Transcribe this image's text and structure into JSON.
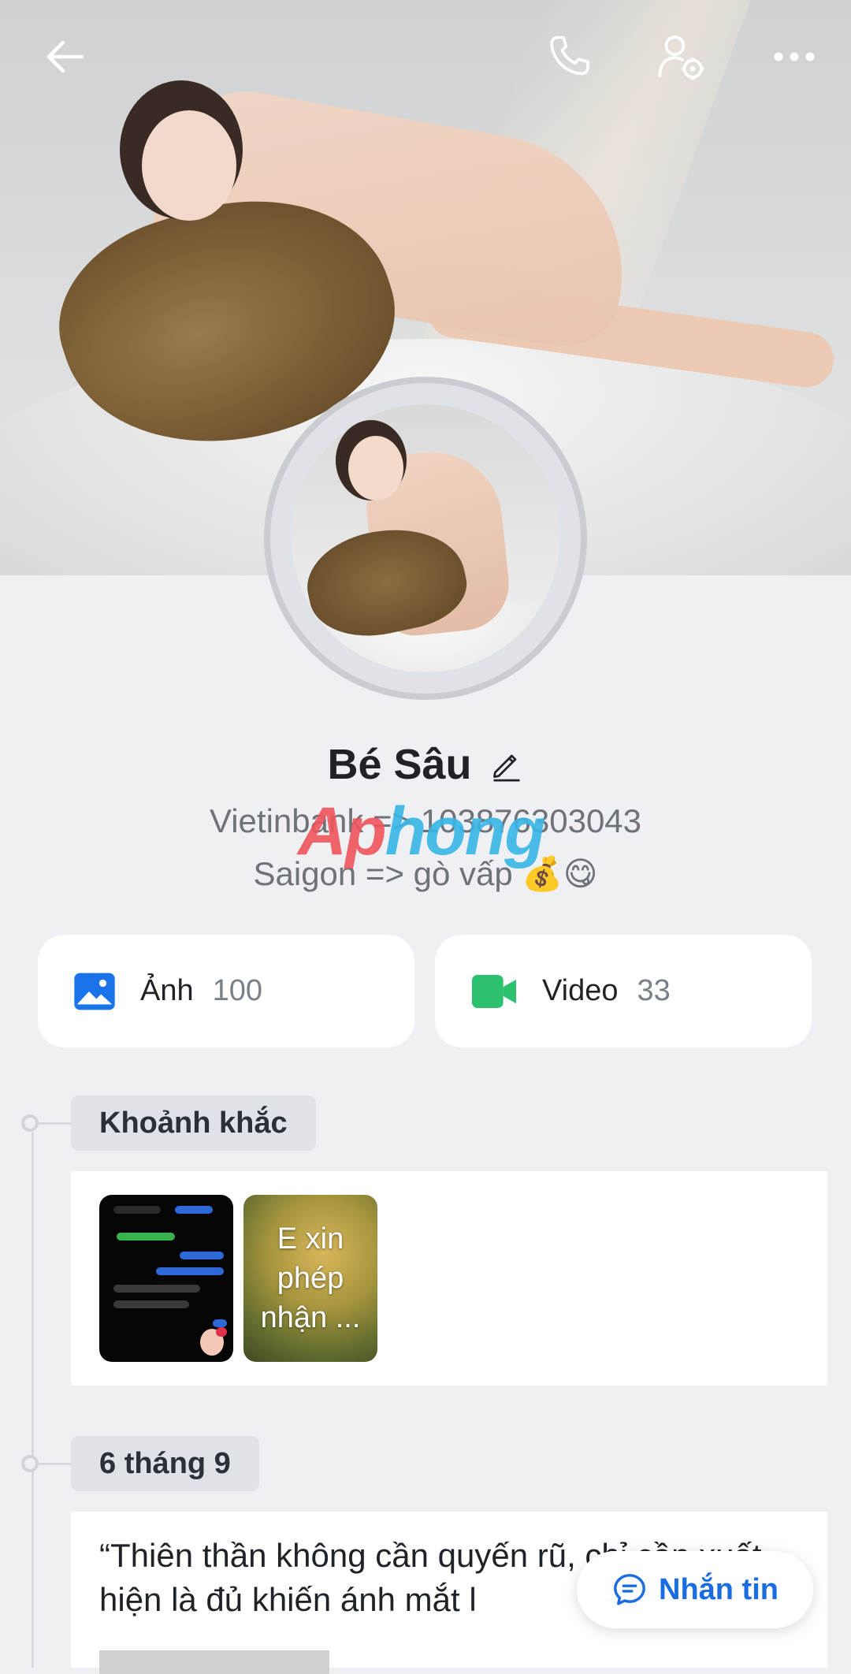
{
  "header": {
    "back_icon": "arrow-left-icon",
    "call_icon": "phone-icon",
    "settings_icon": "user-settings-icon",
    "more_icon": "more-horizontal-icon"
  },
  "profile": {
    "name": "Bé Sâu",
    "bio_line1": "Vietinbank => 103876303043",
    "bio_line2": "Saigon => gò vấp 💰😋",
    "watermark_part1": "Ap",
    "watermark_part2": "hong"
  },
  "media": {
    "photos_label": "Ảnh",
    "photos_count": "100",
    "videos_label": "Video",
    "videos_count": "33"
  },
  "timeline": {
    "moments_title": "Khoảnh khắc",
    "moment2_text": "E xin phép nhận ...",
    "date_title": "6 tháng 9",
    "post_text": "“Thiên thần không cần quyến rũ, chỉ cần xuất hiện là đủ khiến ánh mắt l"
  },
  "fab": {
    "label": "Nhắn tin"
  },
  "colors": {
    "accent": "#1a6de0",
    "photo_icon": "#1a73e8",
    "video_icon": "#2cc16d",
    "background": "#eef0f4"
  }
}
